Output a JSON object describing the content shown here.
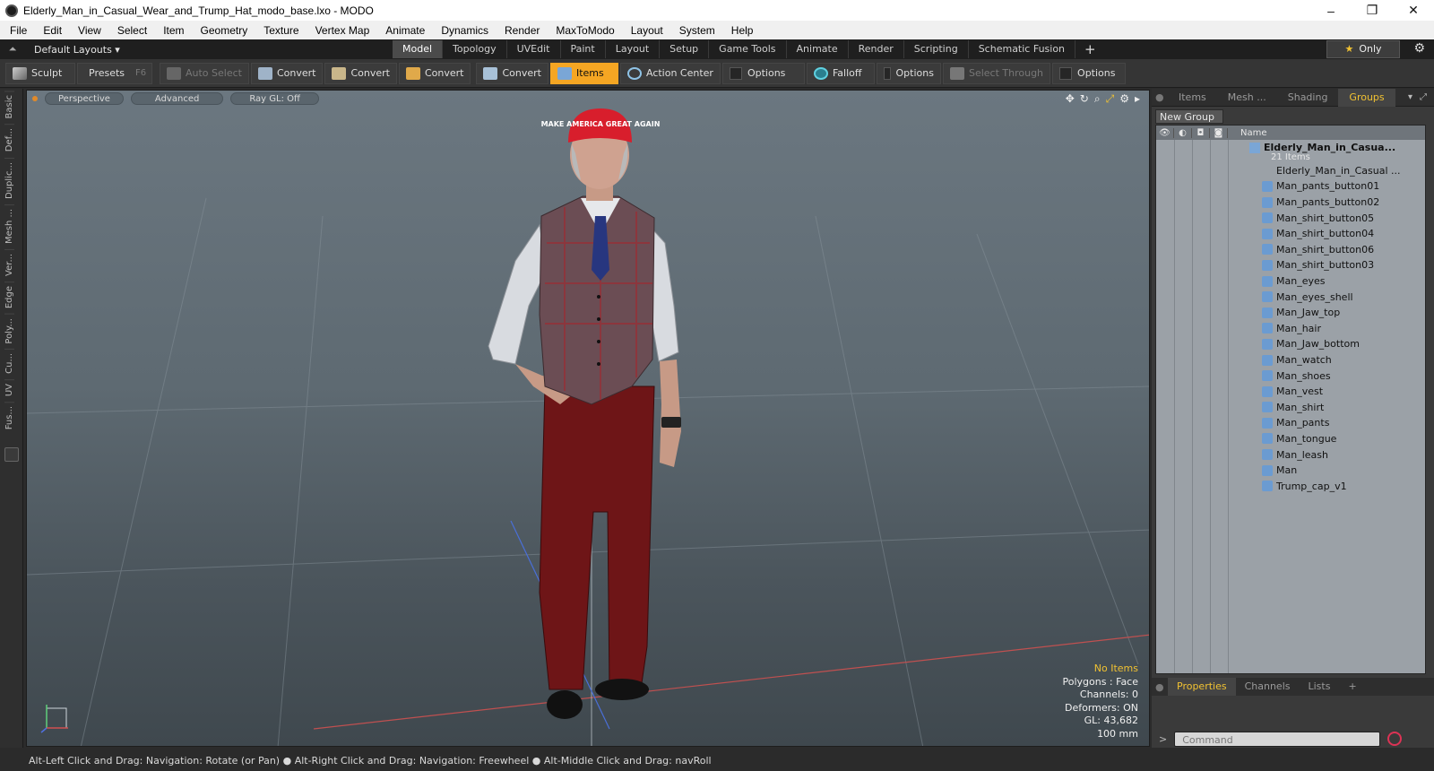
{
  "window": {
    "title": "Elderly_Man_in_Casual_Wear_and_Trump_Hat_modo_base.lxo - MODO",
    "minimize": "–",
    "maximize": "❐",
    "close": "✕"
  },
  "menu": [
    "File",
    "Edit",
    "View",
    "Select",
    "Item",
    "Geometry",
    "Texture",
    "Vertex Map",
    "Animate",
    "Dynamics",
    "Render",
    "MaxToModo",
    "Layout",
    "System",
    "Help"
  ],
  "layout": {
    "dropdown": "Default Layouts ▾",
    "only_label": "Only",
    "tabs": [
      "Model",
      "Topology",
      "UVEdit",
      "Paint",
      "Layout",
      "Setup",
      "Game Tools",
      "Animate",
      "Render",
      "Scripting",
      "Schematic Fusion"
    ],
    "active_tab": "Model",
    "add": "+"
  },
  "toolbar": {
    "sculpt": "Sculpt",
    "presets": "Presets",
    "presets_hotkey": "F6",
    "auto_select": "Auto Select",
    "convert1": "Convert",
    "convert2": "Convert",
    "convert3": "Convert",
    "convert4": "Convert",
    "items": "Items",
    "action_center": "Action Center",
    "options1": "Options",
    "falloff": "Falloff",
    "options2": "Options",
    "select_through": "Select Through",
    "options3": "Options"
  },
  "left_tabs": [
    "Basic",
    "Def...",
    "Duplic...",
    "Mesh ...",
    "Ver...",
    "Edge",
    "Poly...",
    "Cu...",
    "UV",
    "Fus..."
  ],
  "viewport": {
    "perspective": "Perspective",
    "advanced": "Advanced",
    "raygl": "Ray GL: Off",
    "stats": {
      "no_items": "No Items",
      "polygons": "Polygons : Face",
      "channels": "Channels: 0",
      "deformers": "Deformers: ON",
      "gl": "GL: 43,682",
      "scale": "100 mm"
    },
    "hat_text": "MAKE AMERICA GREAT AGAIN"
  },
  "right_panel": {
    "tabs": [
      "Items",
      "Mesh ...",
      "Shading",
      "Groups"
    ],
    "active_tab": "Groups",
    "new_group": "New Group",
    "name_col": "Name",
    "group_name": "Elderly_Man_in_Casua...",
    "group_count": "21 Items",
    "items": [
      "Elderly_Man_in_Casual ...",
      "Man_pants_button01",
      "Man_pants_button02",
      "Man_shirt_button05",
      "Man_shirt_button04",
      "Man_shirt_button06",
      "Man_shirt_button03",
      "Man_eyes",
      "Man_eyes_shell",
      "Man_Jaw_top",
      "Man_hair",
      "Man_Jaw_bottom",
      "Man_watch",
      "Man_shoes",
      "Man_vest",
      "Man_shirt",
      "Man_pants",
      "Man_tongue",
      "Man_leash",
      "Man",
      "Trump_cap_v1"
    ],
    "bottom_tabs": [
      "Properties",
      "Channels",
      "Lists"
    ],
    "bottom_add": "+",
    "command_placeholder": "Command"
  },
  "status": "Alt-Left Click and Drag: Navigation: Rotate (or Pan) ● Alt-Right Click and Drag: Navigation: Freewheel ● Alt-Middle Click and Drag: navRoll"
}
